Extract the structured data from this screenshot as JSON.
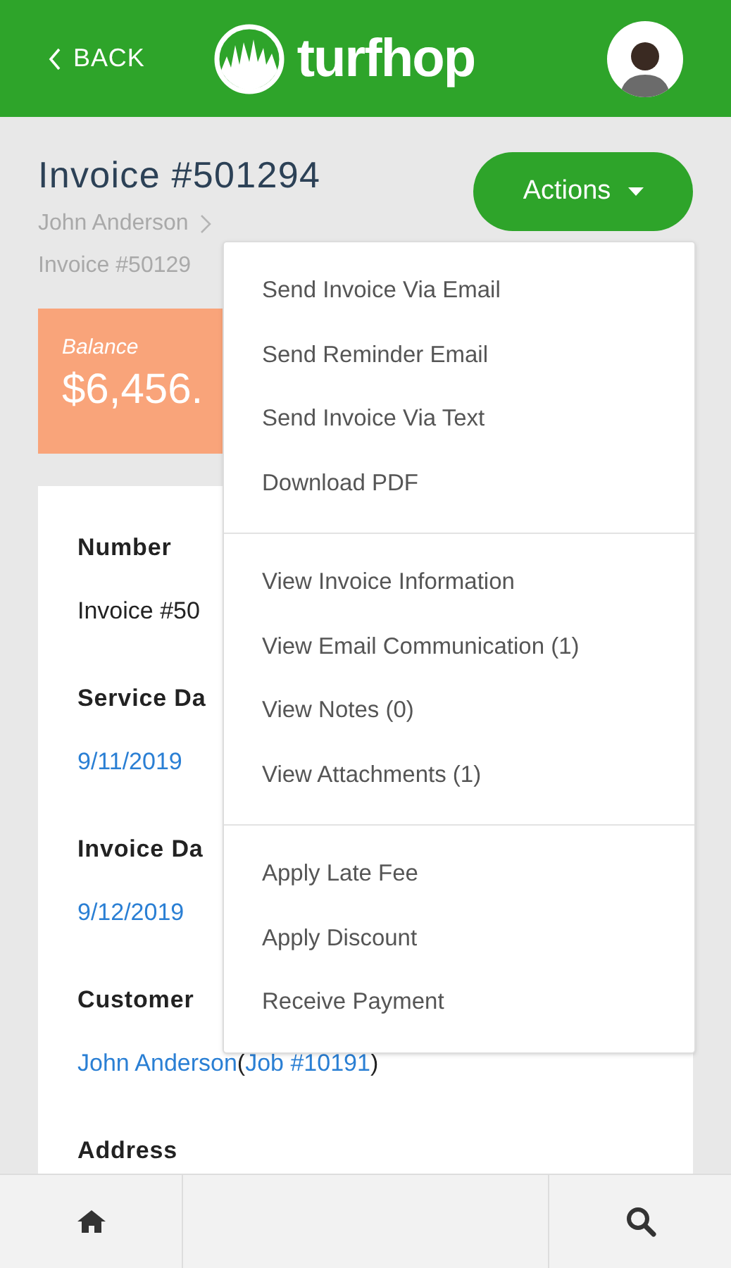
{
  "header": {
    "back": "BACK",
    "logo_text": "turfhop"
  },
  "page": {
    "title": "Invoice #501294",
    "actions_button": "Actions",
    "breadcrumbs": [
      "John Anderson",
      "Invoice #50129"
    ]
  },
  "balance": {
    "label": "Balance",
    "amount": "$6,456."
  },
  "fields": [
    {
      "label": "Number",
      "value": [
        {
          "text": "Invoice #50",
          "link": false
        }
      ]
    },
    {
      "label": "Service Da",
      "value": [
        {
          "text": "9/11/2019",
          "link": true
        }
      ]
    },
    {
      "label": "Invoice Da",
      "value": [
        {
          "text": "9/12/2019",
          "link": true
        }
      ]
    },
    {
      "label": "Customer",
      "value": [
        {
          "text": "John Anderson",
          "link": true
        },
        {
          "text": "(",
          "link": false
        },
        {
          "text": "Job #10191",
          "link": true
        },
        {
          "text": ")",
          "link": false
        }
      ]
    },
    {
      "label": "Address"
    }
  ],
  "actions_menu": [
    [
      "Send Invoice Via Email",
      "Send Reminder Email",
      "Send Invoice Via Text",
      "Download PDF"
    ],
    [
      "View Invoice Information",
      "View Email Communication (1)",
      "View Notes (0)",
      "View Attachments (1)"
    ],
    [
      "Apply Late Fee",
      "Apply Discount",
      "Receive Payment"
    ]
  ]
}
